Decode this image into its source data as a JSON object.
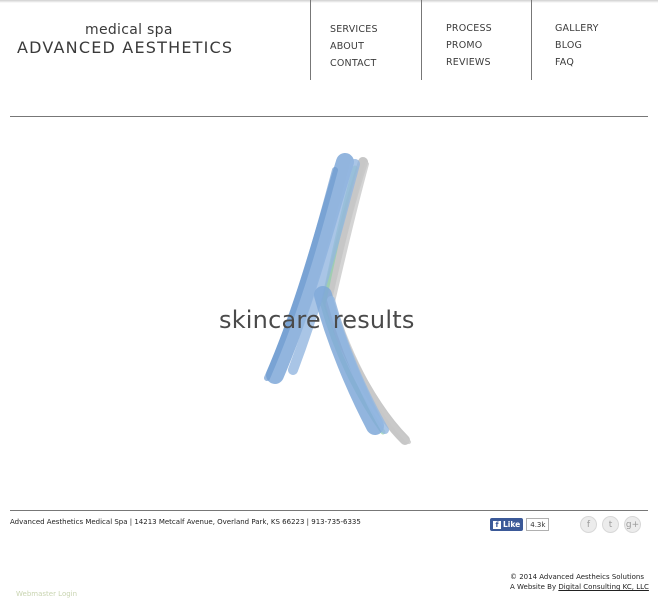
{
  "logo": {
    "small_text": "medical spa",
    "big_text": "ADVANCED AESTHETICS"
  },
  "nav": {
    "col1": [
      "SERVICES",
      "ABOUT",
      "CONTACT"
    ],
    "col2": [
      "PROCESS",
      "PROMO",
      "REVIEWS"
    ],
    "col3": [
      "GALLERY",
      "BLOG",
      "FAQ"
    ]
  },
  "hero": {
    "tagline": "skincare results",
    "brush_colors": {
      "blue": "#7fa8d8",
      "green": "#8fd0a8",
      "gray": "#bdbdbd"
    }
  },
  "footer": {
    "address": "Advanced Aesthetics Medical Spa | 14213 Metcalf Avenue, Overland Park, KS 66223 | 913-735-6335",
    "like_label": "Like",
    "like_count": "4.3k",
    "social": [
      {
        "icon": "facebook-icon",
        "glyph": "f"
      },
      {
        "icon": "twitter-icon",
        "glyph": "t"
      },
      {
        "icon": "google-plus-icon",
        "glyph": "g+"
      }
    ],
    "copyright": "© 2014 Advanced Aestheics Solutions",
    "credit_prefix": "A Website By ",
    "credit_link": "Digital Consulting KC, LLC",
    "webmaster": "Webmaster Login"
  }
}
